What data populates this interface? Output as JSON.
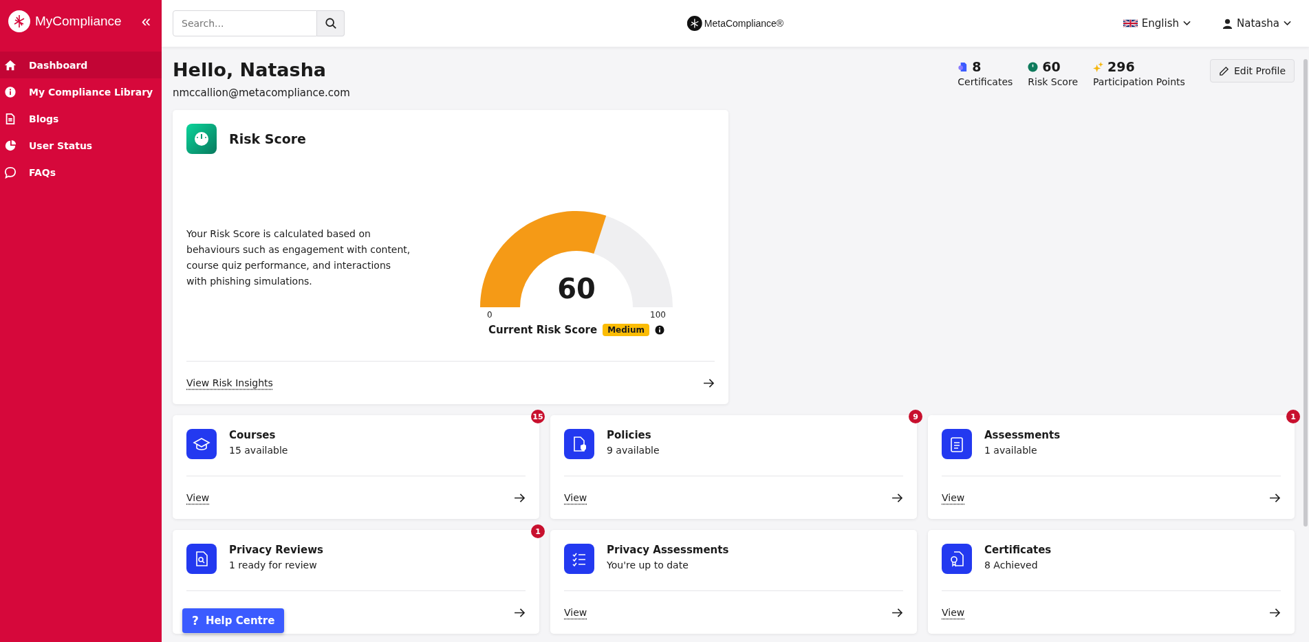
{
  "sidebar": {
    "brand": "MyCompliance",
    "collapse": "«",
    "items": [
      {
        "label": "Dashboard",
        "selected": true
      },
      {
        "label": "My Compliance Library",
        "selected": false
      },
      {
        "label": "Blogs",
        "selected": false
      },
      {
        "label": "User Status",
        "selected": false
      },
      {
        "label": "FAQs",
        "selected": false
      }
    ]
  },
  "header": {
    "search": {
      "placeholder": "Search..."
    },
    "logo": "MetaCompliance®",
    "language": "English",
    "user": "Natasha"
  },
  "profile": {
    "greeting": "Hello, Natasha",
    "email": "nmccallion@metacompliance.com",
    "stats": [
      {
        "value": "8",
        "label": "Certificates"
      },
      {
        "value": "60",
        "label": "Risk Score"
      },
      {
        "value": "296",
        "label": "Participation Points"
      }
    ],
    "edit_button": "Edit Profile"
  },
  "risk_card": {
    "title": "Risk Score",
    "description": "Your Risk Score is calculated based on behaviours such as engagement with content, course quiz performance, and interactions with phishing simulations.",
    "gauge": {
      "level": 0.6,
      "value": "60",
      "min": "0",
      "max": "100"
    },
    "caption": "Current Risk Score",
    "rating": "Medium",
    "link": "View Risk Insights"
  },
  "cards": [
    {
      "title": "Courses",
      "subtitle": "15 available",
      "badge": "15",
      "link": "View"
    },
    {
      "title": "Policies",
      "subtitle": "9 available",
      "badge": "9",
      "link": "View"
    },
    {
      "title": "Assessments",
      "subtitle": "1 available",
      "badge": "1",
      "link": "View"
    },
    {
      "title": "Privacy Reviews",
      "subtitle": "1 ready for review",
      "badge": "1"
    },
    {
      "title": "Privacy Assessments",
      "subtitle": "You're up to date",
      "link": "View"
    },
    {
      "title": "Certificates",
      "subtitle": "8 Achieved",
      "link": "View"
    }
  ],
  "help_button": {
    "icon": "?",
    "label": "Help Centre"
  }
}
